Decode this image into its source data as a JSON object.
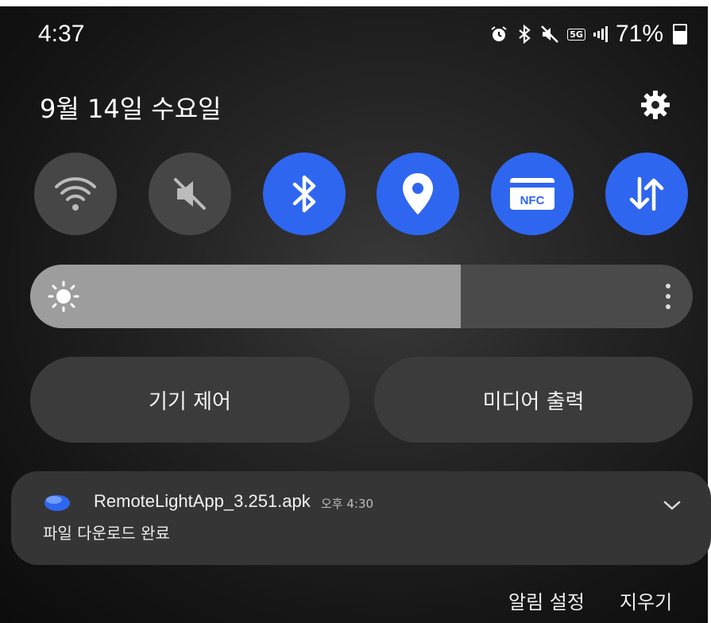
{
  "status_bar": {
    "time": "4:37",
    "network": "5G",
    "battery_percent": "71%",
    "icons": [
      "alarm-icon",
      "bluetooth-icon",
      "mute-icon",
      "5g-icon",
      "signal-icon",
      "battery-icon"
    ]
  },
  "header": {
    "date": "9월 14일 수요일",
    "settings_icon": "gear-icon"
  },
  "quick_settings": [
    {
      "name": "wifi",
      "icon": "wifi-icon",
      "state": "off"
    },
    {
      "name": "sound",
      "icon": "mute-icon",
      "state": "off"
    },
    {
      "name": "bluetooth",
      "icon": "bluetooth-icon",
      "state": "on"
    },
    {
      "name": "location",
      "icon": "location-icon",
      "state": "on"
    },
    {
      "name": "nfc",
      "icon": "nfc-icon",
      "label": "NFC",
      "state": "on"
    },
    {
      "name": "mobile-data",
      "icon": "data-transfer-icon",
      "state": "on"
    }
  ],
  "brightness": {
    "level": 0.65
  },
  "buttons": {
    "device_control": "기기 제어",
    "media_output": "미디어 출력"
  },
  "notification": {
    "app_icon": "download-app-icon",
    "title": "RemoteLightApp_3.251.apk",
    "time": "오후 4:30",
    "body": "파일 다운로드 완료"
  },
  "footer": {
    "notification_settings": "알림 설정",
    "clear": "지우기"
  },
  "colors": {
    "accent_on": "#2f66f0",
    "tile_off": "#464646",
    "panel": "#353535"
  }
}
